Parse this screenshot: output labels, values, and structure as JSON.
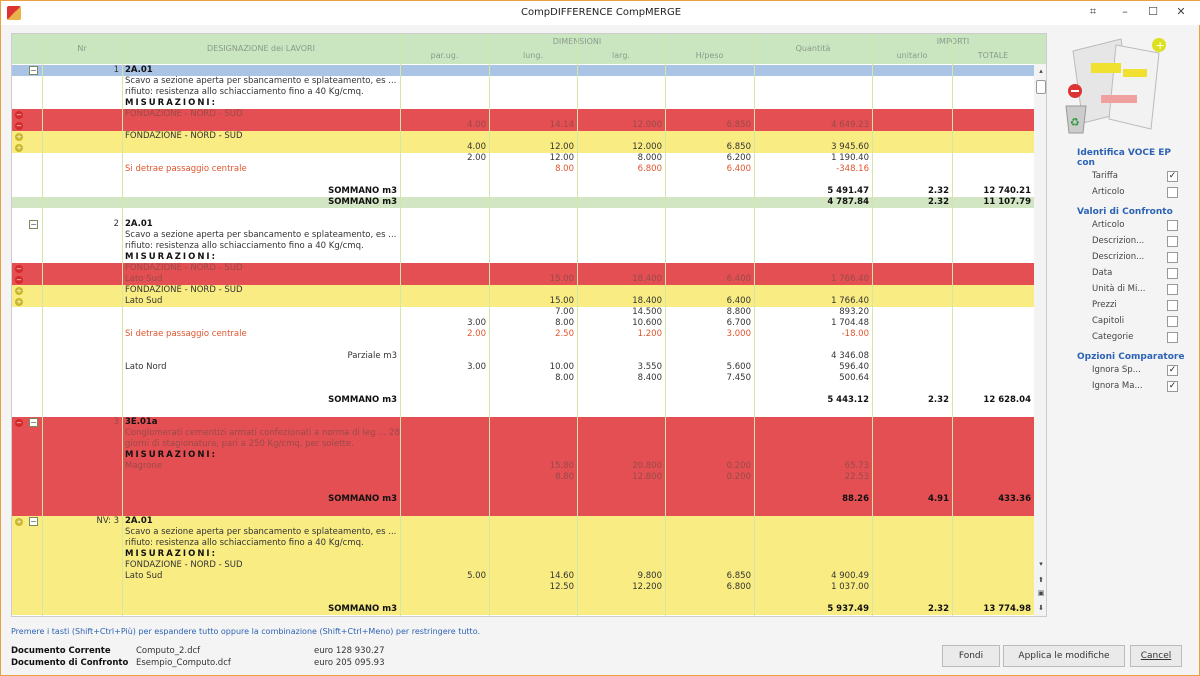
{
  "window": {
    "title": "CompDIFFERENCE CompMERGE"
  },
  "header": {
    "nr": "Nr",
    "designazione": "DESIGNAZIONE dei LAVORI",
    "dimensioni": "DIMENSIONI",
    "par": "par.ug.",
    "lung": "lung.",
    "larg": "larg.",
    "hpeso": "H/peso",
    "quantita": "Quantità",
    "importi": "IMPORTI",
    "unitario": "unitario",
    "totale": "TOTALE"
  },
  "colors": {
    "removed": "#e34f52",
    "added": "#f8ec83",
    "header": "#c9e6c1",
    "item": "#a9c4e4"
  },
  "rows": [
    {
      "bg": "blue",
      "exp": true,
      "nr": "1",
      "d": "2A.01",
      "st": "b"
    },
    {
      "d": "Scavo a sezione aperta per sbancamento e splateamento, es ..."
    },
    {
      "d": "rifiuto: resistenza allo schiacciamento fino a 40 Kg/cmq."
    },
    {
      "d": "MISURAZIONI:",
      "st": "m"
    },
    {
      "bg": "red",
      "mark": "minus",
      "d": "FONDAZIONE - NORD - SUD"
    },
    {
      "bg": "red",
      "mark": "minus",
      "v": [
        "4.00",
        "14.14",
        "12.000",
        "6.850",
        "4 649.23",
        "",
        ""
      ]
    },
    {
      "bg": "yellow",
      "mark": "plus",
      "d": "FONDAZIONE - NORD - SUD"
    },
    {
      "bg": "yellow",
      "mark": "plus",
      "v": [
        "4.00",
        "12.00",
        "12.000",
        "6.850",
        "3 945.60",
        "",
        ""
      ]
    },
    {
      "v": [
        "2.00",
        "12.00",
        "8.000",
        "6.200",
        "1 190.40",
        "",
        ""
      ]
    },
    {
      "st": "r",
      "d": "Si detrae passaggio centrale",
      "v": [
        "",
        "8.00",
        "6.800",
        "6.400",
        "-348.16",
        "",
        ""
      ]
    },
    {},
    {
      "st": "s",
      "dr": "SOMMANO m3",
      "v": [
        "",
        "",
        "",
        "",
        "5 491.47",
        "2.32",
        "12 740.21"
      ]
    },
    {
      "bg": "green",
      "st": "s",
      "dr": "SOMMANO m3",
      "v": [
        "",
        "",
        "",
        "",
        "4 787.84",
        "2.32",
        "11 107.79"
      ]
    },
    {},
    {
      "exp": true,
      "nr": "2",
      "d": "2A.01",
      "st": "b"
    },
    {
      "d": "Scavo a sezione aperta per sbancamento e splateamento, es ..."
    },
    {
      "d": "rifiuto: resistenza allo schiacciamento fino a 40 Kg/cmq."
    },
    {
      "d": "MISURAZIONI:",
      "st": "m"
    },
    {
      "bg": "red",
      "mark": "minus",
      "d": "FONDAZIONE - NORD - SUD"
    },
    {
      "bg": "red",
      "mark": "minus",
      "d": "Lato Sud",
      "v": [
        "",
        "15.00",
        "18.400",
        "6.400",
        "1 766.40",
        "",
        ""
      ]
    },
    {
      "bg": "yellow",
      "mark": "plus",
      "d": "FONDAZIONE - NORD - SUD"
    },
    {
      "bg": "yellow",
      "mark": "plus",
      "d": "Lato Sud",
      "v": [
        "",
        "15.00",
        "18.400",
        "6.400",
        "1 766.40",
        "",
        ""
      ]
    },
    {
      "v": [
        "",
        "7.00",
        "14.500",
        "8.800",
        "893.20",
        "",
        ""
      ]
    },
    {
      "v": [
        "3.00",
        "8.00",
        "10.600",
        "6.700",
        "1 704.48",
        "",
        ""
      ]
    },
    {
      "st": "r",
      "d": "Si detrae passaggio centrale",
      "v": [
        "2.00",
        "2.50",
        "1.200",
        "3.000",
        "-18.00",
        "",
        ""
      ]
    },
    {},
    {
      "dr": "Parziale m3",
      "v": [
        "",
        "",
        "",
        "",
        "4 346.08",
        "",
        ""
      ]
    },
    {
      "d": "Lato Nord",
      "v": [
        "3.00",
        "10.00",
        "3.550",
        "5.600",
        "596.40",
        "",
        ""
      ]
    },
    {
      "v": [
        "",
        "8.00",
        "8.400",
        "7.450",
        "500.64",
        "",
        ""
      ]
    },
    {},
    {
      "st": "s",
      "dr": "SOMMANO m3",
      "v": [
        "",
        "",
        "",
        "",
        "5 443.12",
        "2.32",
        "12 628.04"
      ]
    },
    {},
    {
      "bg": "red",
      "mark": "minus",
      "exp": true,
      "nr": "3",
      "d": "3E.01a",
      "st": "b"
    },
    {
      "bg": "red",
      "d": "Conglomerati cementizi armati confezionati a norma di leg ... 28"
    },
    {
      "bg": "red",
      "d": "giorni di stagionatura, pari a 250 Kg/cmq, per solette."
    },
    {
      "bg": "red",
      "d": "MISURAZIONI:",
      "st": "m"
    },
    {
      "bg": "red",
      "d": "Magrone",
      "v": [
        "",
        "15.80",
        "20.800",
        "0.200",
        "65.73",
        "",
        ""
      ]
    },
    {
      "bg": "red",
      "v": [
        "",
        "8.80",
        "12.800",
        "0.200",
        "22.53",
        "",
        ""
      ]
    },
    {
      "bg": "red"
    },
    {
      "bg": "red",
      "st": "s",
      "dr": "SOMMANO m3",
      "v": [
        "",
        "",
        "",
        "",
        "88.26",
        "4.91",
        "433.36"
      ]
    },
    {
      "bg": "red"
    },
    {
      "bg": "yellow",
      "mark": "plus",
      "exp": true,
      "nr": "NV: 3",
      "d": "2A.01",
      "st": "b"
    },
    {
      "bg": "yellow",
      "d": "Scavo a sezione aperta per sbancamento e splateamento, es ..."
    },
    {
      "bg": "yellow",
      "d": "rifiuto: resistenza allo schiacciamento fino a 40 Kg/cmq."
    },
    {
      "bg": "yellow",
      "d": "MISURAZIONI:",
      "st": "m"
    },
    {
      "bg": "yellow",
      "d": "FONDAZIONE - NORD - SUD"
    },
    {
      "bg": "yellow",
      "d": "Lato Sud",
      "v": [
        "5.00",
        "14.60",
        "9.800",
        "6.850",
        "4 900.49",
        "",
        ""
      ]
    },
    {
      "bg": "yellow",
      "v": [
        "",
        "12.50",
        "12.200",
        "6.800",
        "1 037.00",
        "",
        ""
      ]
    },
    {
      "bg": "yellow"
    },
    {
      "bg": "yellow",
      "st": "s",
      "dr": "SOMMANO m3",
      "v": [
        "",
        "",
        "",
        "",
        "5 937.49",
        "2.32",
        "13 774.98"
      ]
    }
  ],
  "side": {
    "sec1": "Identifica VOCE EP con",
    "opts1": [
      {
        "label": "Tariffa",
        "checked": true
      },
      {
        "label": "Articolo",
        "checked": false
      }
    ],
    "sec2": "Valori di Confronto",
    "opts2": [
      {
        "label": "Articolo",
        "checked": false
      },
      {
        "label": "Descrizion...",
        "checked": false
      },
      {
        "label": "Descrizion...",
        "checked": false
      },
      {
        "label": "Data",
        "checked": false
      },
      {
        "label": "Unità di Mi...",
        "checked": false
      },
      {
        "label": "Prezzi",
        "checked": false
      },
      {
        "label": "Capitoli",
        "checked": false
      },
      {
        "label": "Categorie",
        "checked": false
      }
    ],
    "sec3": "Opzioni Comparatore",
    "opts3": [
      {
        "label": "Ignora Sp...",
        "checked": true
      },
      {
        "label": "Ignora Ma...",
        "checked": true
      }
    ]
  },
  "footer": {
    "hint": "Premere i tasti (Shift+Ctrl+Più) per espandere tutto oppure la combinazione (Shift+Ctrl+Meno)  per restringere tutto.",
    "doc1_label": "Documento Corrente",
    "doc1_file": "Computo_2.dcf",
    "doc1_total": "euro 128 930.27",
    "doc2_label": "Documento di Confronto",
    "doc2_file": "Esempio_Computo.dcf",
    "doc2_total": "euro 205 095.93",
    "fondi": "Fondi",
    "applica": "Applica le modifiche",
    "cancel": "Cancel"
  }
}
